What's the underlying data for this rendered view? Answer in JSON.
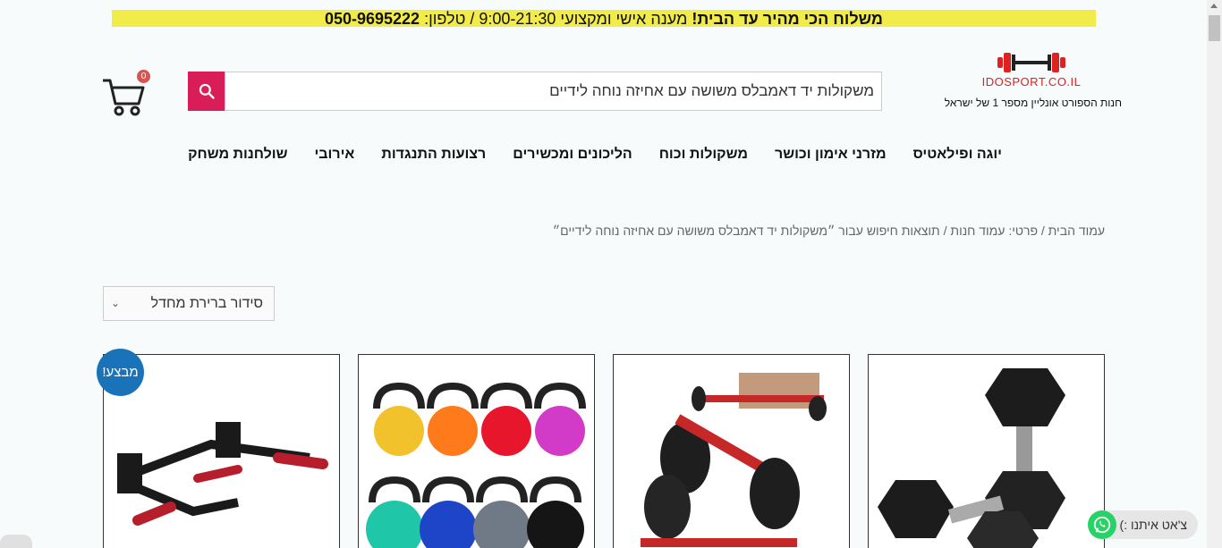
{
  "topbar": {
    "bold": "משלוח הכי מהיר עד הבית!",
    "middle": " מענה אישי ומקצועי 9:00-21:30 / טלפון: ",
    "phone": "050-9695222"
  },
  "logo": {
    "text": "IDOSPORT.CO.IL",
    "tagline": "חנות הספורט אונליין מספר 1 של ישראל"
  },
  "search": {
    "value": "משקולות יד דאמבלס משושה עם אחיזה נוחה לידיים"
  },
  "cart": {
    "count": "0"
  },
  "nav": {
    "items": [
      {
        "label": "יוגה ופילאטיס"
      },
      {
        "label": "מזרני אימון וכושר"
      },
      {
        "label": "משקולות וכוח"
      },
      {
        "label": "הליכונים ומכשירים"
      },
      {
        "label": "רצועות התנגדות"
      },
      {
        "label": "אירובי"
      },
      {
        "label": "שולחנות משחק"
      }
    ]
  },
  "breadcrumb": {
    "text": "עמוד הבית / פרטי: עמוד חנות / תוצאות חיפוש עבור ״משקולות יד דאמבלס משושה עם אחיזה נוחה לידיים״"
  },
  "sort": {
    "selected": "סידור ברירת מחדל"
  },
  "products": {
    "sale_label": "מבצע!"
  },
  "chat": {
    "label": "צ'אט איתנו :)"
  },
  "colors": {
    "accent": "#d81d58",
    "topbar": "#f2ec4a",
    "sale": "#1a73b8",
    "whatsapp": "#25d366"
  }
}
